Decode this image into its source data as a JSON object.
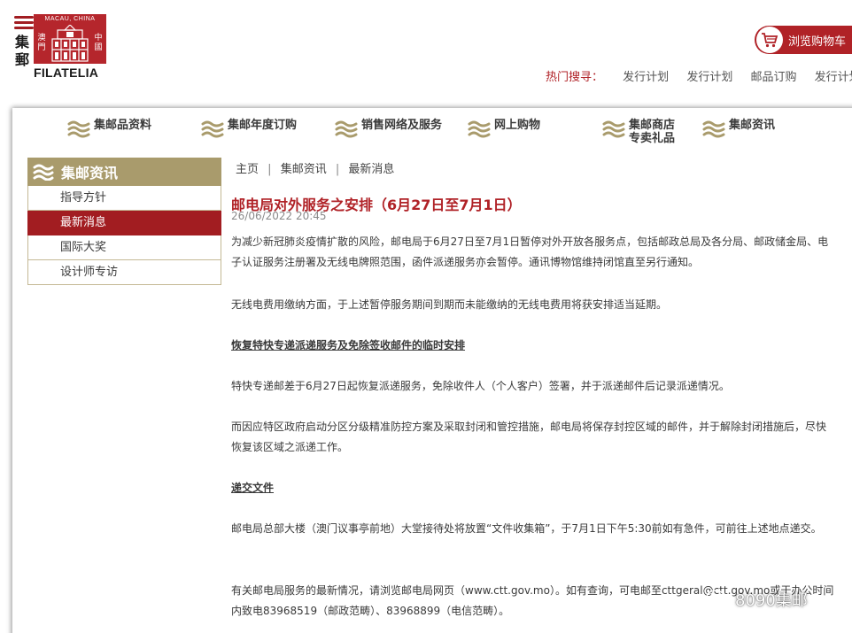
{
  "logo": {
    "macau_china": "MACAU, CHINA",
    "jiyou": "集\n郵",
    "aomen": "澳\n門",
    "zhongguo": "中\n國",
    "filatelia": "FILATELIA"
  },
  "header": {
    "cart_label": "浏览购物车",
    "hot_label": "热门搜寻：",
    "hot_links": [
      "发行计划",
      "发行计划",
      "邮品订购",
      "发行计划"
    ]
  },
  "nav": [
    {
      "label": "集邮品资料"
    },
    {
      "label": "集邮年度订购"
    },
    {
      "label": "销售网络及服务"
    },
    {
      "label": "网上购物"
    },
    {
      "label": "集邮商店\n专卖礼品"
    },
    {
      "label": "集邮资讯"
    }
  ],
  "sidebar": {
    "title": "集邮资讯",
    "items": [
      {
        "label": "指导方针"
      },
      {
        "label": "最新消息"
      },
      {
        "label": "国际大奖"
      },
      {
        "label": "设计师专访"
      }
    ]
  },
  "breadcrumb": [
    "主页",
    "集邮资讯",
    "最新消息"
  ],
  "breadcrumb_sep": "|",
  "article": {
    "title": "邮电局对外服务之安排（6月27日至7月1日）",
    "date": "26/06/2022 20:45",
    "paragraphs": [
      "为减少新冠肺炎疫情扩散的风险，邮电局于6月27日至7月1日暂停对外开放各服务点，包括邮政总局及各分局、邮政储金局、电子认证服务注册署及无线电牌照范围，函件派递服务亦会暂停。通讯博物馆维持闭馆直至另行通知。",
      "无线电费用缴纳方面，于上述暂停服务期间到期而未能缴纳的无线电费用将获安排适当延期。",
      "恢复特快专递派递服务及免除签收邮件的临时安排",
      "特快专递邮差于6月27日起恢复派递服务，免除收件人（个人客户）签署，并于派递邮件后记录派递情况。",
      "而因应特区政府启动分区分级精准防控方案及采取封闭和管控措施，邮电局将保存封控区域的邮件，并于解除封闭措施后，尽快恢复该区域之派递工作。",
      "递交文件",
      "邮电局总部大楼（澳门议事亭前地）大堂接待处将放置“文件收集箱”，于7月1日下午5:30前如有急件，可前往上述地点递交。",
      "有关邮电局服务的最新情况，请浏览邮电局网页（www.ctt.gov.mo）。如有查询，可电邮至cttgeral@ctt.gov.mo或于办公时间内致电83968519（邮政范畴）、83968899（电信范畴）。"
    ]
  },
  "watermark": "8090集邮",
  "colors": {
    "brand_red": "#b02227",
    "gold": "#a99b6c",
    "active_red": "#a21d21"
  }
}
